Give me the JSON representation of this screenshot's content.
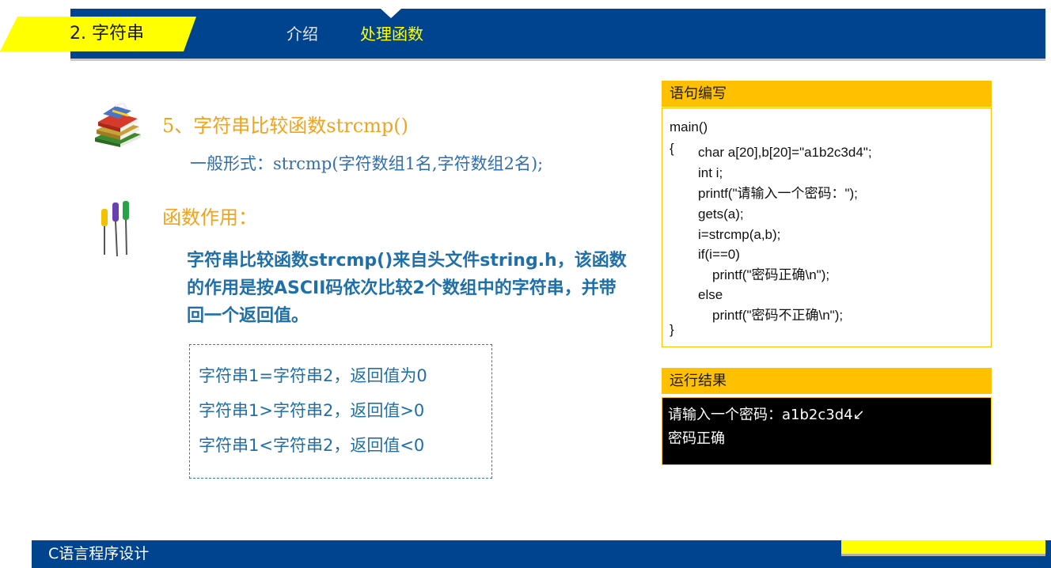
{
  "header": {
    "section_title": "2. 字符串",
    "tabs": [
      {
        "label": "介绍",
        "active": false
      },
      {
        "label": "处理函数",
        "active": true
      }
    ]
  },
  "content": {
    "heading": "5、字符串比较函数strcmp()",
    "general_form": "一般形式：strcmp(字符数组1名,字符数组2名);",
    "func_heading": "函数作用：",
    "description": "字符串比较函数strcmp()来自头文件string.h，该函数的作用是按ASCII码依次比较2个数组中的字符串，并带回一个返回值。",
    "rules": [
      "字符串1=字符串2，返回值为0",
      "字符串1>字符串2，返回值>0",
      "字符串1<字符串2，返回值<0"
    ]
  },
  "code_panel": {
    "title": "语句编写",
    "lines": [
      "main()",
      "{",
      "char a[20],b[20]=\"a1b2c3d4\";",
      "int i;",
      "printf(\"请输入一个密码：\");",
      "gets(a);",
      "i=strcmp(a,b);",
      "if(i==0)",
      "printf(\"密码正确\\n\");",
      "else",
      "printf(\"密码不正确\\n\");",
      "}"
    ]
  },
  "result_panel": {
    "title": "运行结果",
    "lines": [
      "请输入一个密码：a1b2c3d4↙",
      "密码正确"
    ]
  },
  "footer": {
    "title": "C语言程序设计"
  },
  "colors": {
    "primary_blue": "#00438f",
    "accent_yellow": "#ffff00",
    "panel_orange": "#ffc000",
    "heading_orange": "#f3a21b",
    "text_blue": "#1f6fa8"
  }
}
